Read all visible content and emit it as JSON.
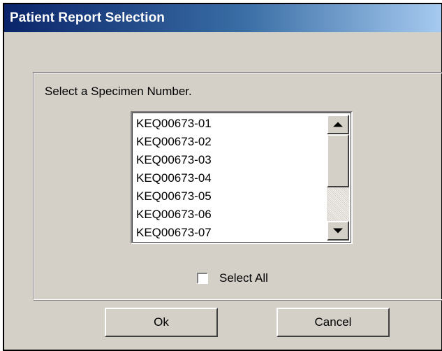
{
  "window": {
    "title": "Patient Report Selection"
  },
  "groupbox": {
    "prompt": "Select a Specimen Number."
  },
  "specimens": [
    "KEQ00673-01",
    "KEQ00673-02",
    "KEQ00673-03",
    "KEQ00673-04",
    "KEQ00673-05",
    "KEQ00673-06",
    "KEQ00673-07"
  ],
  "select_all": {
    "label": "Select All",
    "checked": false
  },
  "buttons": {
    "ok": "Ok",
    "cancel": "Cancel"
  },
  "colors": {
    "title_start": "#0a246a",
    "title_end": "#a6caf0",
    "face": "#d4d0c8"
  }
}
